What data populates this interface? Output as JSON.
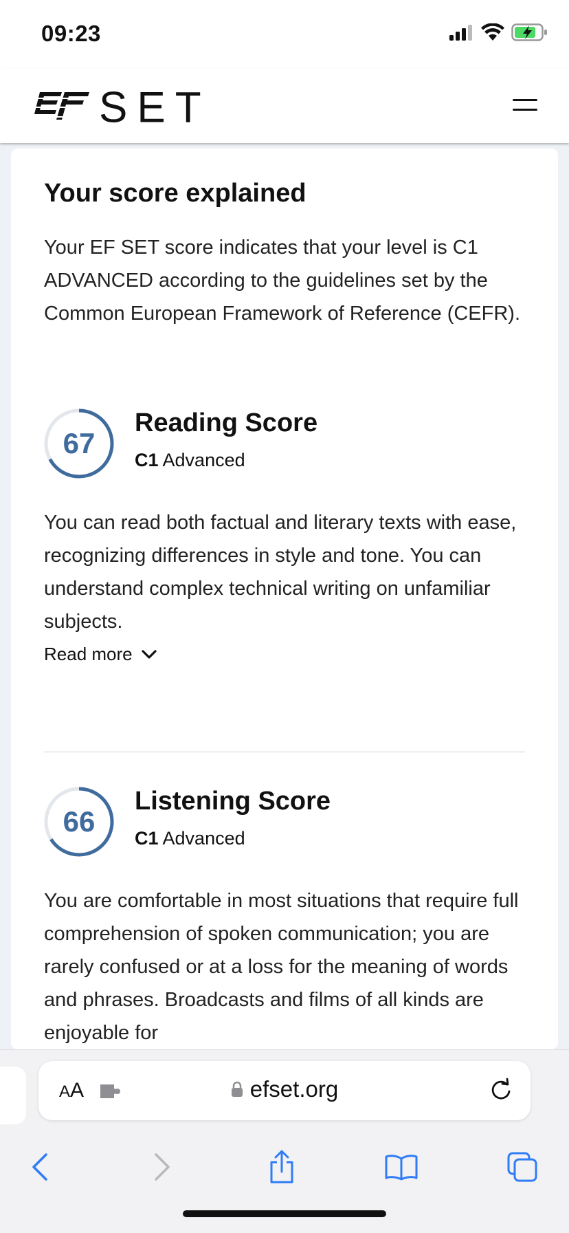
{
  "status_bar": {
    "time": "09:23"
  },
  "header": {
    "logo_text": "SET",
    "logo_mark": "EF"
  },
  "main": {
    "title": "Your score explained",
    "intro": "Your EF SET score indicates that your level is C1 ADVANCED according to the guidelines set by the Common European Framework of Reference (CEFR).",
    "scores": [
      {
        "score": "67",
        "score_fraction": 0.67,
        "title": "Reading Score",
        "level_code": "C1",
        "level_name": "Advanced",
        "description": "You can read both factual and literary texts with ease, recognizing differences in style and tone. You can understand complex technical writing on unfamiliar subjects.",
        "read_more": "Read more"
      },
      {
        "score": "66",
        "score_fraction": 0.66,
        "title": "Listening Score",
        "level_code": "C1",
        "level_name": "Advanced",
        "description": "You are comfortable in most situations that require full comprehension of spoken communication; you are rarely confused or at a loss for the meaning of words and phrases. Broadcasts and films of all kinds are enjoyable for"
      }
    ]
  },
  "browser": {
    "text_size_label_big": "A",
    "text_size_label_small": "A",
    "url": "efset.org"
  },
  "colors": {
    "accent": "#3f6b9d",
    "safari_blue": "#2f7cf6"
  }
}
